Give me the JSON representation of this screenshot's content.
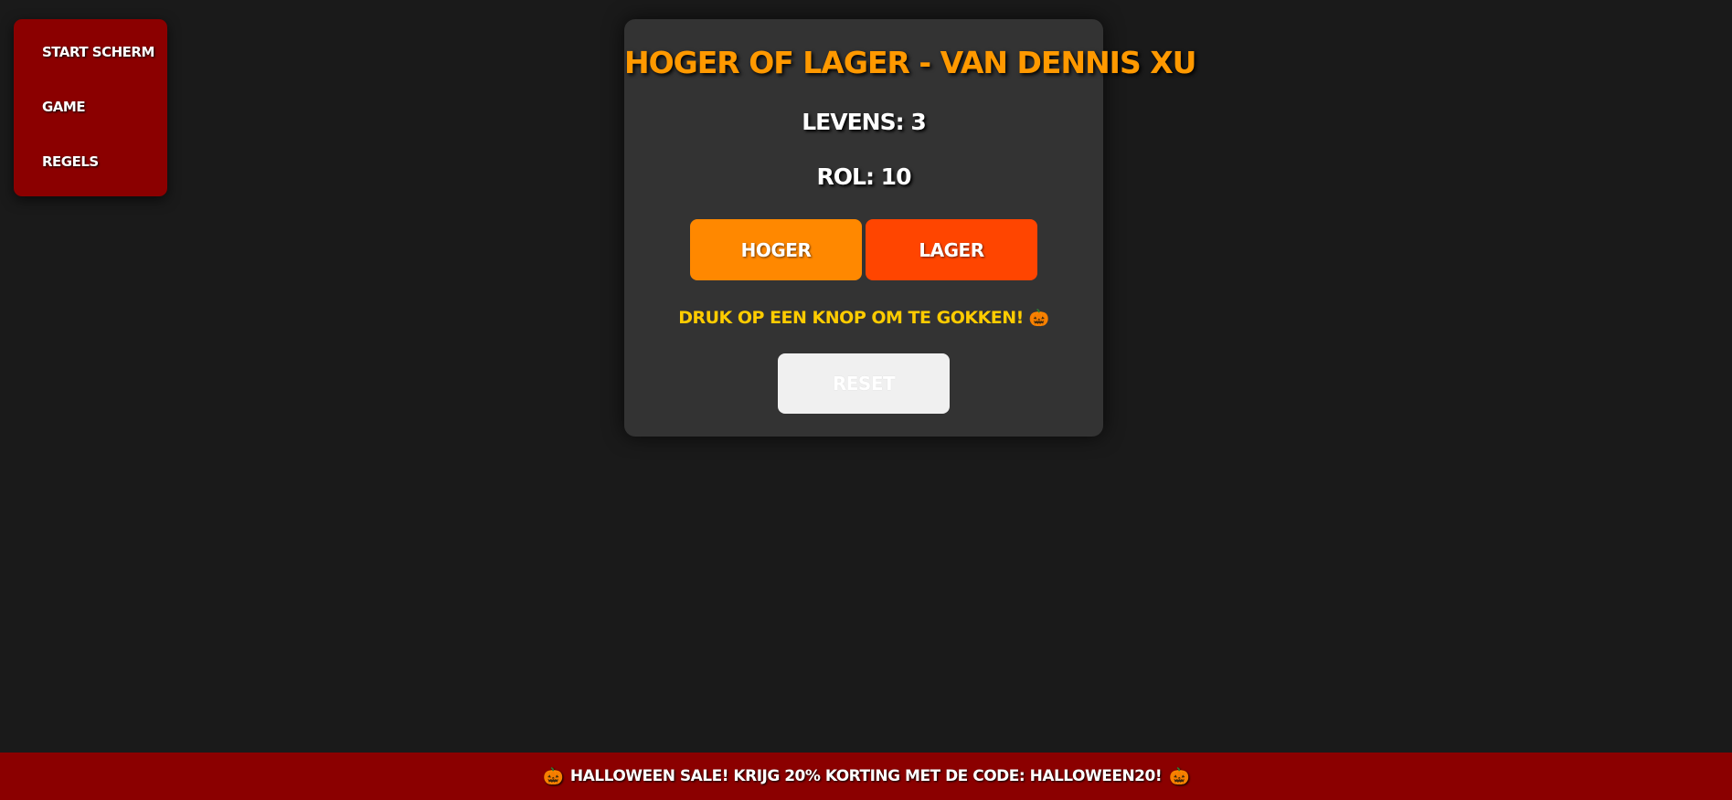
{
  "menu": {
    "items": [
      {
        "label": "Start Scherm"
      },
      {
        "label": "Game"
      },
      {
        "label": "Regels"
      }
    ]
  },
  "game": {
    "title": "Hoger of Lager - van Dennis Xu",
    "lives_label": "Levens: ",
    "lives_value": "3",
    "roll_label": "Rol: ",
    "roll_value": "10",
    "higher_label": "Hoger",
    "lower_label": "Lager",
    "message": "Druk op een knop om te gokken!",
    "reset_label": "Reset"
  },
  "footer": {
    "text": "Halloween Sale! Krijg 20% korting met de code: HALLOWEEN20!"
  },
  "icons": {
    "pumpkin": "🎃"
  },
  "colors": {
    "background": "#1a1a1a",
    "menu_bg": "#8b0000",
    "card_bg": "#333333",
    "title": "#ff9900",
    "higher_button": "#ff8800",
    "lower_button": "#ff4500",
    "message": "#ffcc00",
    "reset_button": "#f0f0f0",
    "footer_bg": "#8b0000"
  }
}
